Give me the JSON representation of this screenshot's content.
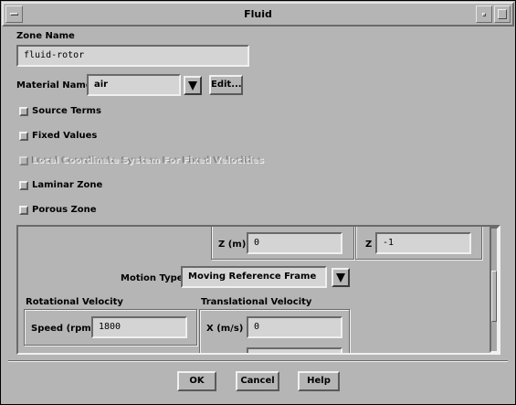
{
  "window": {
    "title": "Fluid"
  },
  "zone_name": {
    "label": "Zone Name",
    "value": "fluid-rotor"
  },
  "material": {
    "label": "Material Name",
    "value": "air",
    "edit_label": "Edit..."
  },
  "options": [
    {
      "label": "Source Terms",
      "checked": false,
      "enabled": true
    },
    {
      "label": "Fixed Values",
      "checked": false,
      "enabled": true
    },
    {
      "label": "Local Coordinate System For Fixed Velocities",
      "checked": false,
      "enabled": false
    },
    {
      "label": "Laminar Zone",
      "checked": false,
      "enabled": true
    },
    {
      "label": "Porous Zone",
      "checked": false,
      "enabled": true
    }
  ],
  "motion": {
    "z_origin_label": "Z (m)",
    "z_origin_value": "0",
    "z_axis_label": "Z",
    "z_axis_value": "-1",
    "motion_type_label": "Motion Type",
    "motion_type_value": "Moving Reference Frame",
    "rotational_title": "Rotational Velocity",
    "speed_label": "Speed (rpm)",
    "speed_value": "1800",
    "translational_title": "Translational Velocity",
    "x_label": "X (m/s)",
    "x_value": "0"
  },
  "footer": {
    "ok": "OK",
    "cancel": "Cancel",
    "help": "Help"
  }
}
